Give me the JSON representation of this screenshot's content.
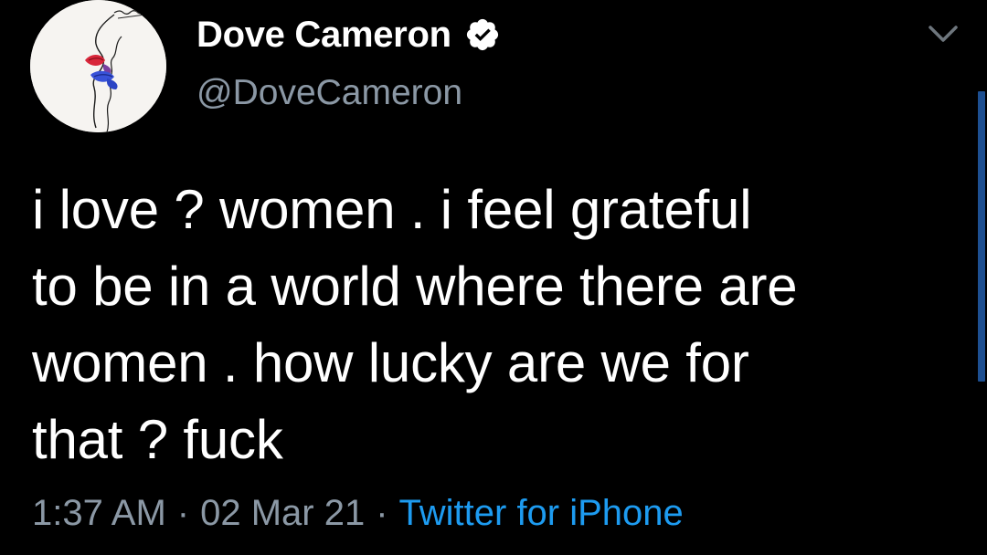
{
  "author": {
    "display_name": "Dove Cameron",
    "handle": "@DoveCameron",
    "verified_icon": "verified-badge-icon",
    "avatar_icon": "avatar-illustration"
  },
  "tweet": {
    "lines": [
      "i love ? women . i feel grateful",
      "to be in a world where there are",
      "women . how lucky are we for",
      "that ? fuck"
    ]
  },
  "meta": {
    "time": "1:37 AM",
    "date": "02 Mar 21",
    "separator": "·",
    "source": "Twitter for iPhone"
  },
  "controls": {
    "menu_icon": "chevron-down-icon"
  },
  "colors": {
    "background": "#000000",
    "text": "#ffffff",
    "muted": "#8b98a5",
    "link": "#1d9bf0",
    "scroll_indicator": "#1d4f91"
  }
}
